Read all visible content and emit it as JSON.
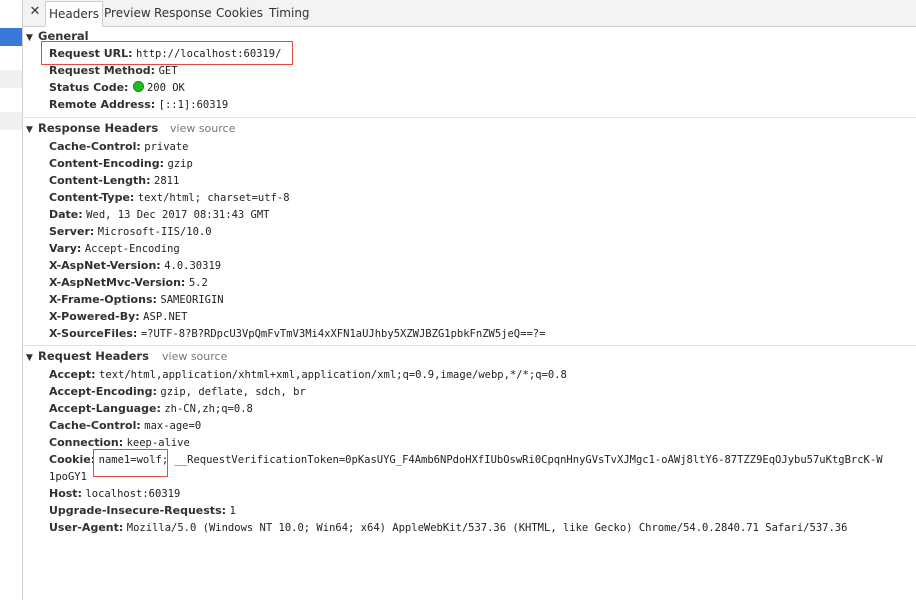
{
  "tabs": {
    "close_glyph": "✕",
    "items": [
      "Headers",
      "Preview",
      "Response",
      "Cookies",
      "Timing"
    ],
    "active": "Headers"
  },
  "general": {
    "title": "General",
    "rows": [
      {
        "name": "Request URL:",
        "value": "http://localhost:60319/"
      },
      {
        "name": "Request Method:",
        "value": "GET"
      },
      {
        "name": "Status Code:",
        "value": "200 OK"
      },
      {
        "name": "Remote Address:",
        "value": "[::1]:60319"
      }
    ]
  },
  "response_headers": {
    "title": "Response Headers",
    "view_source": "view source",
    "rows": [
      {
        "name": "Cache-Control:",
        "value": "private"
      },
      {
        "name": "Content-Encoding:",
        "value": "gzip"
      },
      {
        "name": "Content-Length:",
        "value": "2811"
      },
      {
        "name": "Content-Type:",
        "value": "text/html; charset=utf-8"
      },
      {
        "name": "Date:",
        "value": "Wed, 13 Dec 2017 08:31:43 GMT"
      },
      {
        "name": "Server:",
        "value": "Microsoft-IIS/10.0"
      },
      {
        "name": "Vary:",
        "value": "Accept-Encoding"
      },
      {
        "name": "X-AspNet-Version:",
        "value": "4.0.30319"
      },
      {
        "name": "X-AspNetMvc-Version:",
        "value": "5.2"
      },
      {
        "name": "X-Frame-Options:",
        "value": "SAMEORIGIN"
      },
      {
        "name": "X-Powered-By:",
        "value": "ASP.NET"
      },
      {
        "name": "X-SourceFiles:",
        "value": "=?UTF-8?B?RDpcU3VpQmFvTmV3Mi4xXFN1aUJhby5XZWJBZG1pbkFnZW5jeQ==?="
      }
    ]
  },
  "request_headers": {
    "title": "Request Headers",
    "view_source": "view source",
    "rows": [
      {
        "name": "Accept:",
        "value": "text/html,application/xhtml+xml,application/xml;q=0.9,image/webp,*/*;q=0.8"
      },
      {
        "name": "Accept-Encoding:",
        "value": "gzip, deflate, sdch, br"
      },
      {
        "name": "Accept-Language:",
        "value": "zh-CN,zh;q=0.8"
      },
      {
        "name": "Cache-Control:",
        "value": "max-age=0"
      },
      {
        "name": "Connection:",
        "value": "keep-alive"
      },
      {
        "name": "Cookie:",
        "value": "name1=wolf; __RequestVerificationToken=0pKasUYG_F4Amb6NPdoHXfIUbOswRi0CpqnHnyGVsTvXJMgc1-oAWj8ltY6-87TZZ9EqOJybu57uKtgBrcK-W"
      },
      {
        "name": "",
        "value": "1poGY1"
      },
      {
        "name": "Host:",
        "value": "localhost:60319"
      },
      {
        "name": "Upgrade-Insecure-Requests:",
        "value": "1"
      },
      {
        "name": "User-Agent:",
        "value": "Mozilla/5.0 (Windows NT 10.0; Win64; x64) AppleWebKit/537.36 (KHTML, like Gecko) Chrome/54.0.2840.71 Safari/537.36"
      }
    ]
  },
  "colors": {
    "status_ok": "#1fbf1f",
    "highlight_box": "#e24a4a",
    "active_row": "#3879d9"
  }
}
